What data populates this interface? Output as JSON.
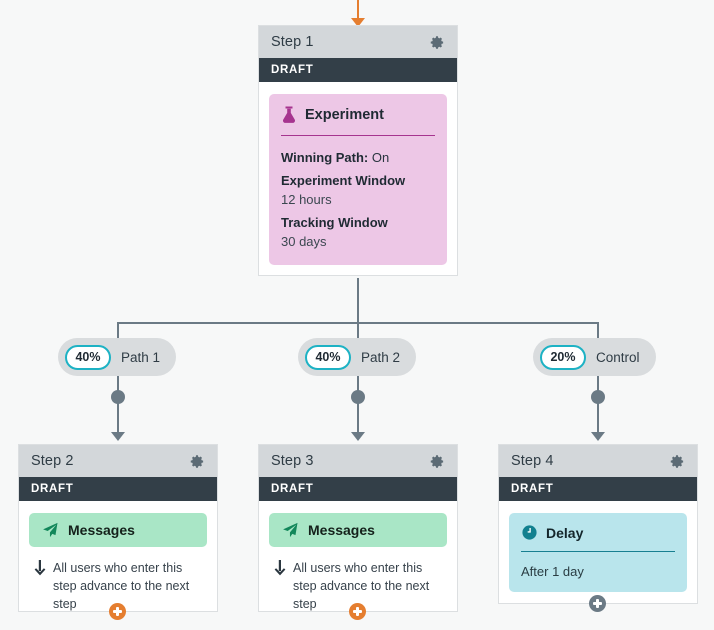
{
  "canvas": {
    "background": "#f7f8f8",
    "connector_color": "#6b7a85",
    "accent_orange": "#e57e30",
    "teal": "#1db2c4"
  },
  "entry_arrow": {
    "icon": "arrow-down-icon",
    "color": "#e57e30"
  },
  "steps": [
    {
      "id": "step1",
      "title": "Step 1",
      "status": "DRAFT",
      "gear_icon": "gear-icon",
      "block": {
        "kind": "experiment",
        "icon": "flask-icon",
        "title": "Experiment",
        "rows": [
          {
            "label": "Winning Path:",
            "value": "On",
            "inline": true
          },
          {
            "label": "Experiment Window",
            "value": "12 hours",
            "inline": false
          },
          {
            "label": "Tracking Window",
            "value": "30 days",
            "inline": false
          }
        ]
      }
    },
    {
      "id": "step2",
      "title": "Step 2",
      "status": "DRAFT",
      "gear_icon": "gear-icon",
      "block": {
        "kind": "messages",
        "icon": "paper-plane-icon",
        "title": "Messages",
        "advance_icon": "arrow-down-icon",
        "advance_text": "All users who enter this step advance to the next step"
      },
      "add_button": {
        "icon": "plus-icon",
        "color": "#e57e30"
      }
    },
    {
      "id": "step3",
      "title": "Step 3",
      "status": "DRAFT",
      "gear_icon": "gear-icon",
      "block": {
        "kind": "messages",
        "icon": "paper-plane-icon",
        "title": "Messages",
        "advance_icon": "arrow-down-icon",
        "advance_text": "All users who enter this step advance to the next step"
      },
      "add_button": {
        "icon": "plus-icon",
        "color": "#e57e30"
      }
    },
    {
      "id": "step4",
      "title": "Step 4",
      "status": "DRAFT",
      "gear_icon": "gear-icon",
      "block": {
        "kind": "delay",
        "icon": "clock-icon",
        "title": "Delay",
        "value": "After 1 day"
      },
      "add_button": {
        "icon": "plus-icon",
        "color": "#6b7a85"
      }
    }
  ],
  "branches": [
    {
      "id": "branch-path-1",
      "percent": "40%",
      "label": "Path 1"
    },
    {
      "id": "branch-path-2",
      "percent": "40%",
      "label": "Path 2"
    },
    {
      "id": "branch-control",
      "percent": "20%",
      "label": "Control"
    }
  ]
}
